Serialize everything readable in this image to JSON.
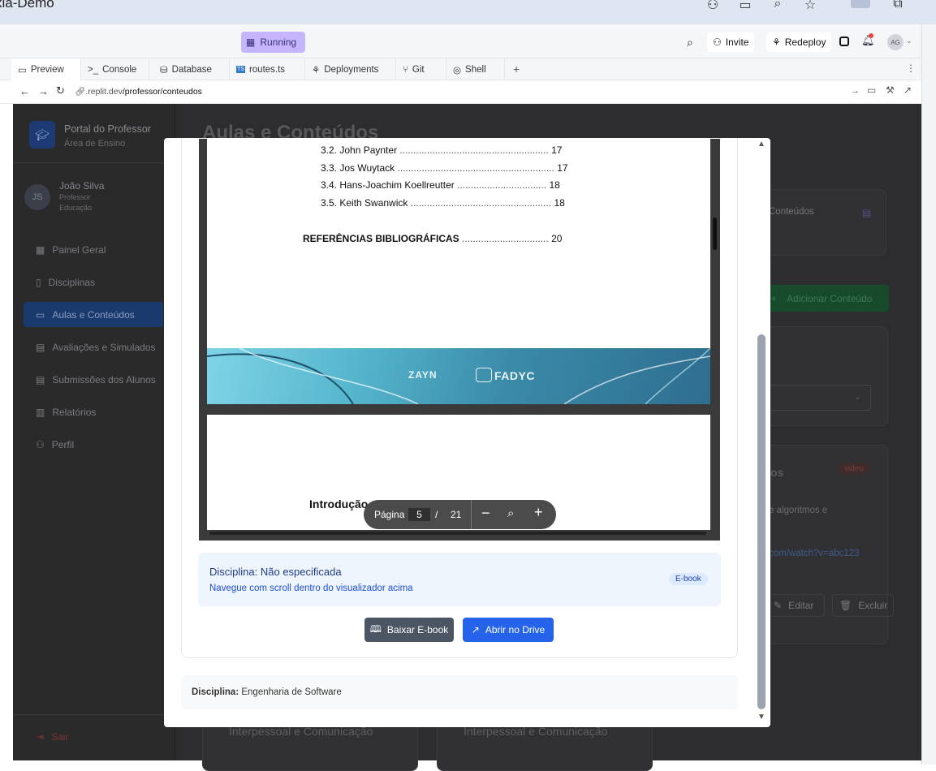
{
  "window": {
    "title": "xia-Demo"
  },
  "devbar": {
    "status": "Running",
    "invite": "Invite",
    "redeploy": "Redeploy",
    "avatar": "AG"
  },
  "tabs": [
    {
      "label": "Preview"
    },
    {
      "label": "Console"
    },
    {
      "label": "Database"
    },
    {
      "label": "routes.ts"
    },
    {
      "label": "Deployments"
    },
    {
      "label": "Git"
    },
    {
      "label": "Shell"
    }
  ],
  "url": {
    "host": ".replit.dev",
    "path": "/professor/conteudos"
  },
  "sidebar": {
    "brand_title": "Portal do Professor",
    "brand_sub": "Área de Ensino",
    "user": {
      "initials": "JS",
      "name": "João Silva",
      "role": "Professor",
      "dept": "Educação"
    },
    "items": [
      {
        "label": "Painel Geral"
      },
      {
        "label": "Disciplinas"
      },
      {
        "label": "Aulas e Conteúdos"
      },
      {
        "label": "Avaliações e Simulados"
      },
      {
        "label": "Submissões dos Alunos"
      },
      {
        "label": "Relatórios"
      },
      {
        "label": "Perfil"
      }
    ],
    "logout": "Sair"
  },
  "main": {
    "title": "Aulas e Conteúdos",
    "card_conteudos": "Conteúdos",
    "add_button": "Adicionar Conteúdo",
    "video_badge": "video",
    "video_text": "e algoritmos e",
    "video_link": "com/watch?v=abc123",
    "edit": "Editar",
    "delete": "Excluir",
    "os_text": "os",
    "bottom_card_1": "Interpessoal e Comunicação",
    "bottom_card_2": "Interpessoal e Comunicação"
  },
  "viewer": {
    "toc": [
      {
        "label": "3.2. John Paynter",
        "page": "17"
      },
      {
        "label": "3.3. Jos Wuytack",
        "page": "17"
      },
      {
        "label": "3.4. Hans-Joachim Koellreutter",
        "page": "18"
      },
      {
        "label": "3.5. Keith Swanwick",
        "page": "18"
      }
    ],
    "refs": {
      "label": "REFERÊNCIAS BIBLIOGRÁFICAS",
      "page": "20"
    },
    "banner_logo_1": "ZAYN",
    "banner_logo_2": "FADYC",
    "page2_heading": "Introdução",
    "page_label": "Página",
    "current_page": "5",
    "separator": "/",
    "total_pages": "21"
  },
  "info": {
    "discipline_label": "Disciplina: Não especificada",
    "hint": "Navegue com scroll dentro do visualizador acima",
    "type_badge": "E-book"
  },
  "buttons": {
    "download": "Baixar E-book",
    "drive": "Abrir no Drive"
  },
  "footer": {
    "label": "Disciplina:",
    "value": "Engenharia de Software"
  }
}
